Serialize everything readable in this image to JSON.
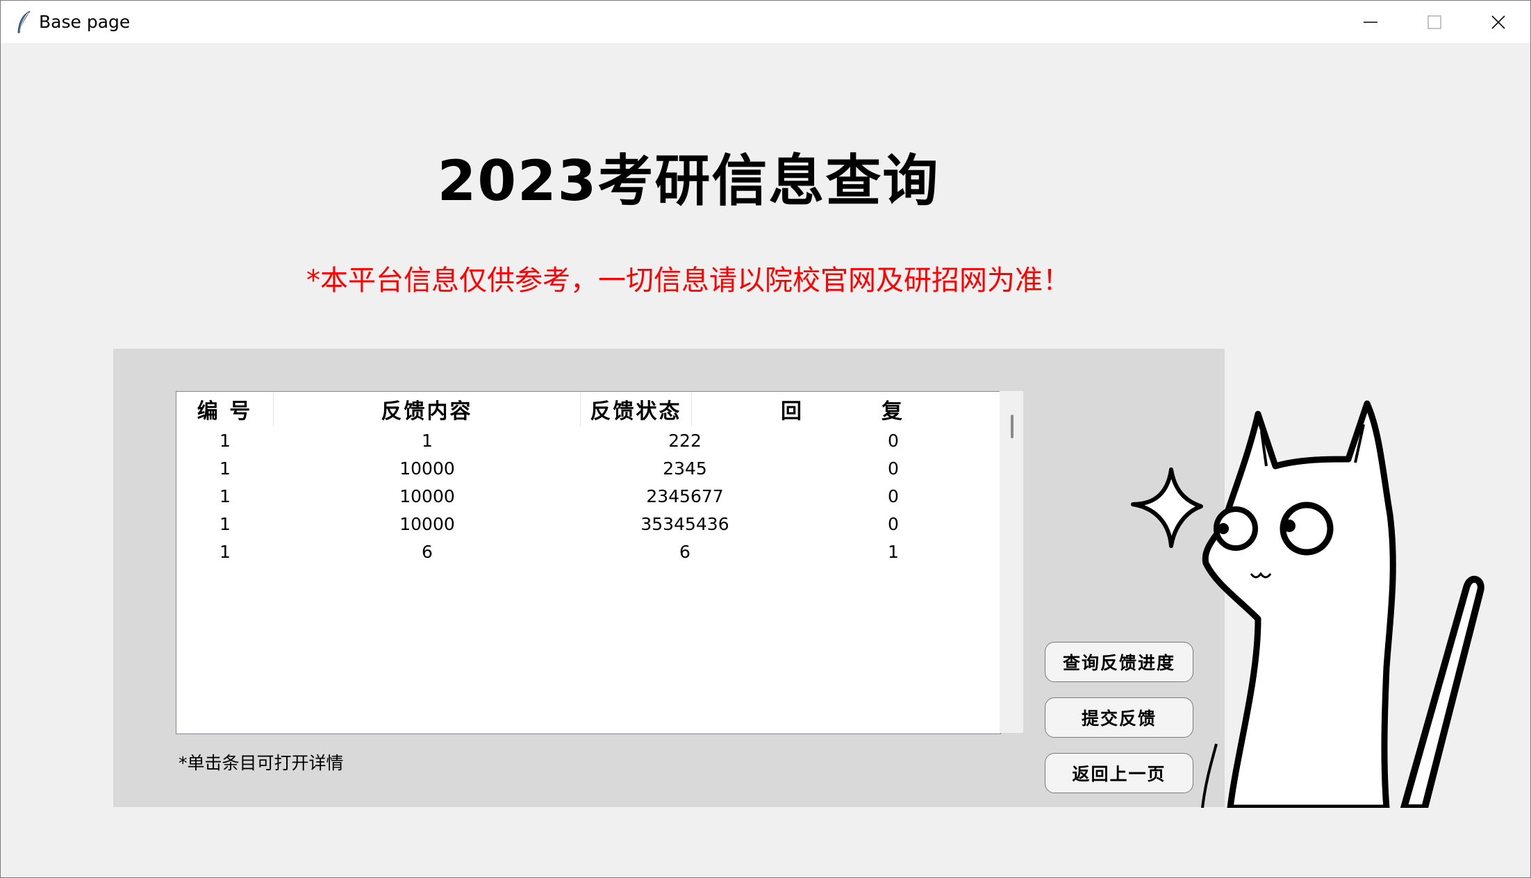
{
  "window": {
    "title": "Base page"
  },
  "page": {
    "title": "2023考研信息查询",
    "notice": "*本平台信息仅供参考，一切信息请以院校官网及研招网为准！",
    "hint": "*单击条目可打开详情"
  },
  "table": {
    "columns": [
      "编 号",
      "反馈内容",
      "反馈状态",
      "回",
      "复"
    ],
    "rows": [
      {
        "id": "1",
        "content": "1",
        "status": "222",
        "reply": "0"
      },
      {
        "id": "1",
        "content": "10000",
        "status": "2345",
        "reply": "0"
      },
      {
        "id": "1",
        "content": "10000",
        "status": "2345677",
        "reply": "0"
      },
      {
        "id": "1",
        "content": "10000",
        "status": "35345436",
        "reply": "0"
      },
      {
        "id": "1",
        "content": "6",
        "status": "6",
        "reply": "1"
      }
    ]
  },
  "buttons": {
    "query_progress": "查询反馈进度",
    "submit_feedback": "提交反馈",
    "back": "返回上一页"
  },
  "colors": {
    "notice": "#ff0000",
    "background": "#f0f0f0",
    "panel": "#d9d9d9"
  },
  "icons": {
    "app": "feather-icon",
    "minimize": "minimize-icon",
    "maximize": "maximize-icon",
    "close": "close-icon"
  }
}
